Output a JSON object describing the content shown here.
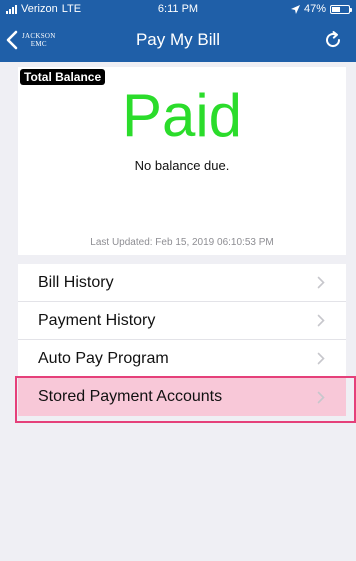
{
  "status_bar": {
    "carrier": "Verizon",
    "network": "LTE",
    "time": "6:11 PM",
    "battery": "47%",
    "battery_level": 0.47
  },
  "nav": {
    "logo_line1": "JACKSON",
    "logo_line2": "EMC",
    "title": "Pay My Bill"
  },
  "balance": {
    "badge": "Total Balance",
    "status": "Paid",
    "message": "No balance due.",
    "last_updated": "Last Updated: Feb 15, 2019 06:10:53 PM"
  },
  "menu": {
    "items": [
      {
        "label": "Bill History"
      },
      {
        "label": "Payment History"
      },
      {
        "label": "Auto Pay Program"
      },
      {
        "label": "Stored Payment Accounts"
      }
    ]
  },
  "colors": {
    "nav_bar": "#1f5fa8",
    "paid_text": "#2bdc2b",
    "highlight_fill": "#f8c8d8",
    "highlight_border": "#e5407a"
  }
}
